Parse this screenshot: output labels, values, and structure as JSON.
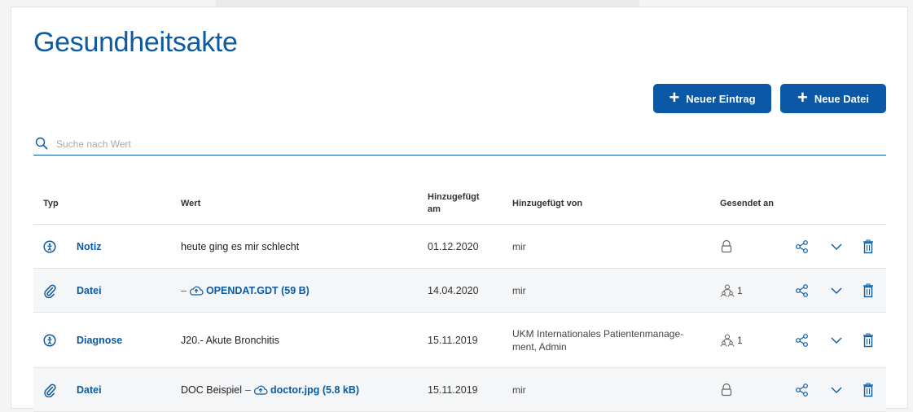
{
  "page": {
    "title": "Gesundheitsakte"
  },
  "toolbar": {
    "new_entry_label": "Neuer Eintrag",
    "new_file_label": "Neue Datei"
  },
  "search": {
    "placeholder": "Suche nach Wert"
  },
  "table": {
    "headers": {
      "type": "Typ",
      "value": "Wert",
      "added_on_line1": "Hinzugefügt",
      "added_on_line2": "am",
      "added_by": "Hinzugefügt von",
      "sent_to": "Gesendet an"
    },
    "rows": [
      {
        "type": "Notiz",
        "type_icon": "note-icon",
        "value_text": "heute ging es mir schlecht",
        "date": "01.12.2020",
        "added_by": "mir",
        "sent_icon": "lock-icon",
        "sent_count": ""
      },
      {
        "type": "Datei",
        "type_icon": "paperclip-icon",
        "value_prefix": "–",
        "file_link": "OPENDAT.GDT (59 B)",
        "date": "14.04.2020",
        "added_by": "mir",
        "sent_icon": "users-icon",
        "sent_count": "1"
      },
      {
        "type": "Diagnose",
        "type_icon": "diagnosis-icon",
        "value_text": "J20.- Akute Bronchitis",
        "date": "15.11.2019",
        "added_by": "UKM Internationales Patientenmanage-ment, Admin",
        "sent_icon": "users-icon",
        "sent_count": "1"
      },
      {
        "type": "Datei",
        "type_icon": "paperclip-icon",
        "value_text": "DOC Beispiel",
        "value_prefix": "–",
        "file_link": "doctor.jpg (5.8 kB)",
        "date": "15.11.2019",
        "added_by": "mir",
        "sent_icon": "lock-icon",
        "sent_count": ""
      }
    ]
  },
  "colors": {
    "primary": "#0b5aa3",
    "button": "#0a58a6",
    "row_alt": "#f5f6f8"
  }
}
